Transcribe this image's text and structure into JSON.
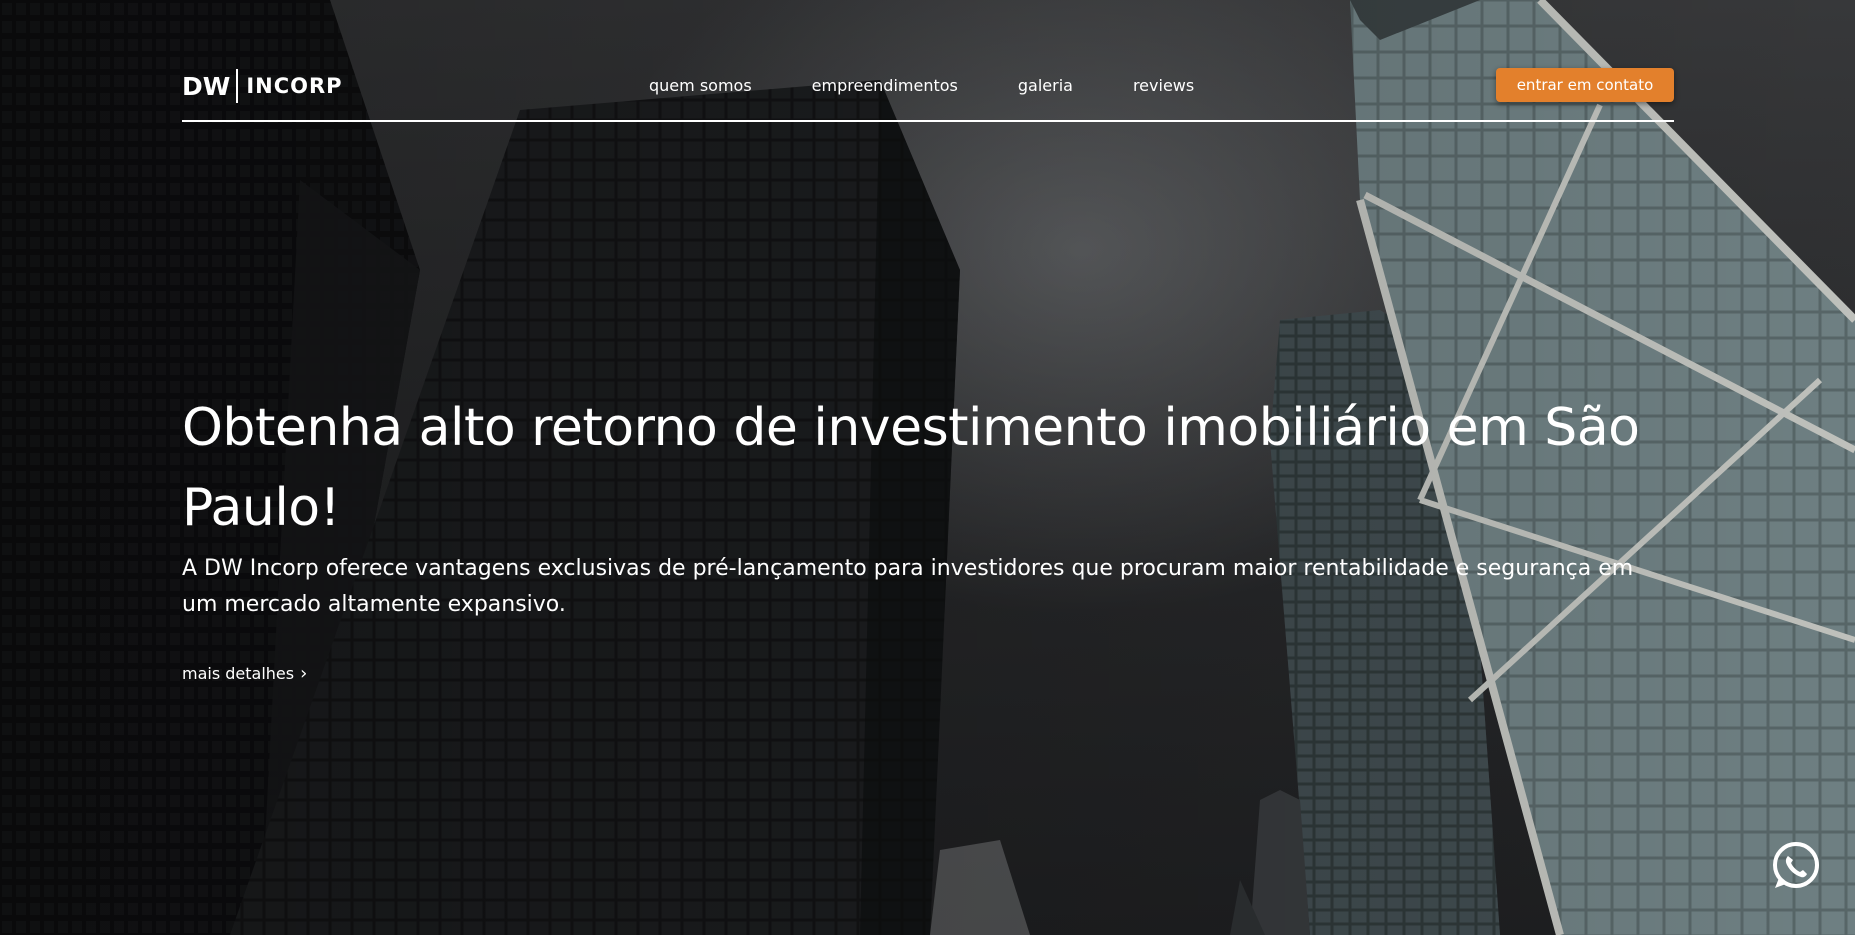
{
  "header": {
    "logo": {
      "left": "DW",
      "right": "INCORP"
    },
    "menu": [
      {
        "label": "quem somos"
      },
      {
        "label": "empreendimentos"
      },
      {
        "label": "galeria"
      },
      {
        "label": "reviews"
      }
    ],
    "cta_label": "entrar em contato"
  },
  "hero": {
    "headline": "Obtenha alto retorno de investimento imobiliário em São Paulo!",
    "subtitle": "A DW Incorp oferece vantagens exclusivas de pré-lançamento para investidores que procuram maior rentabilidade e segurança em um mercado altamente expansivo.",
    "details_link": "mais detalhes"
  },
  "floating": {
    "whatsapp_icon": "whatsapp-icon"
  },
  "colors": {
    "accent": "#e3802c",
    "text": "#ffffff",
    "background": "#2a2b2d"
  }
}
